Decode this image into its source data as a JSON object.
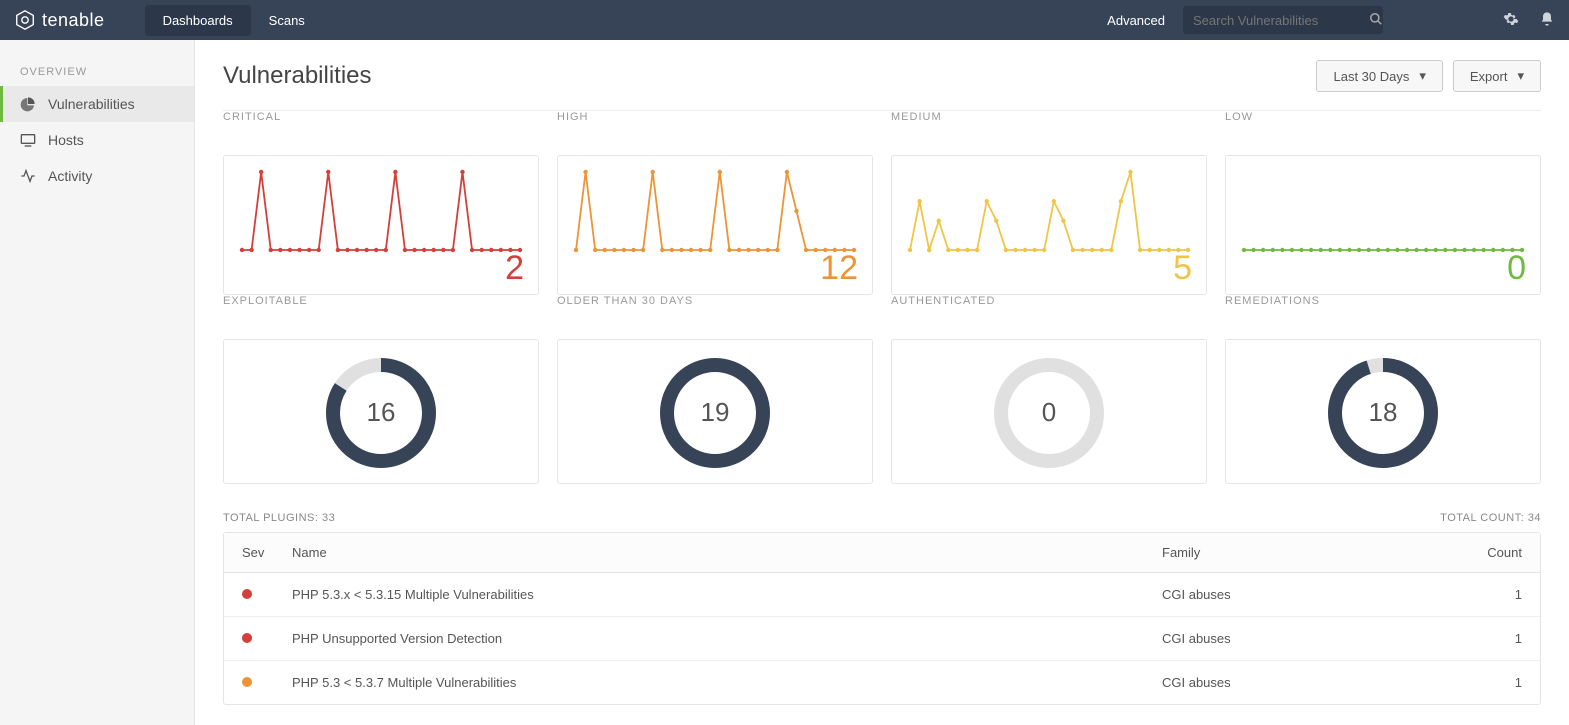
{
  "topbar": {
    "brand": "tenable",
    "nav": {
      "dashboards": "Dashboards",
      "scans": "Scans"
    },
    "advanced": "Advanced",
    "search_placeholder": "Search Vulnerabilities"
  },
  "sidebar": {
    "section": "OVERVIEW",
    "items": {
      "vuln": "Vulnerabilities",
      "hosts": "Hosts",
      "activity": "Activity"
    }
  },
  "page": {
    "title": "Vulnerabilities"
  },
  "buttons": {
    "range": "Last 30 Days",
    "export": "Export"
  },
  "sev_cards": {
    "critical": {
      "label": "CRITICAL",
      "value": "2"
    },
    "high": {
      "label": "HIGH",
      "value": "12"
    },
    "medium": {
      "label": "MEDIUM",
      "value": "5"
    },
    "low": {
      "label": "LOW",
      "value": "0"
    }
  },
  "metric_cards": {
    "exploitable": {
      "label": "EXPLOITABLE",
      "value": "16",
      "pct": 84
    },
    "older": {
      "label": "OLDER THAN 30 DAYS",
      "value": "19",
      "pct": 100
    },
    "auth": {
      "label": "AUTHENTICATED",
      "value": "0",
      "pct": 0
    },
    "remed": {
      "label": "REMEDIATIONS",
      "value": "18",
      "pct": 95
    }
  },
  "table_meta": {
    "plugins": "TOTAL PLUGINS: 33",
    "count": "TOTAL COUNT: 34"
  },
  "columns": {
    "sev": "Sev",
    "name": "Name",
    "family": "Family",
    "count": "Count"
  },
  "rows": [
    {
      "sev": "crit",
      "name": "PHP 5.3.x < 5.3.15 Multiple Vulnerabilities",
      "family": "CGI abuses",
      "count": "1"
    },
    {
      "sev": "crit",
      "name": "PHP Unsupported Version Detection",
      "family": "CGI abuses",
      "count": "1"
    },
    {
      "sev": "high",
      "name": "PHP 5.3 < 5.3.7 Multiple Vulnerabilities",
      "family": "CGI abuses",
      "count": "1"
    }
  ],
  "chart_data": [
    {
      "type": "line",
      "title": "CRITICAL",
      "values": [
        0,
        0,
        2,
        0,
        0,
        0,
        0,
        0,
        0,
        2,
        0,
        0,
        0,
        0,
        0,
        0,
        2,
        0,
        0,
        0,
        0,
        0,
        0,
        2,
        0,
        0,
        0,
        0,
        0,
        0
      ],
      "color": "#d43f3a",
      "ylim": [
        0,
        2
      ]
    },
    {
      "type": "line",
      "title": "HIGH",
      "values": [
        0,
        12,
        0,
        0,
        0,
        0,
        0,
        0,
        12,
        0,
        0,
        0,
        0,
        0,
        0,
        12,
        0,
        0,
        0,
        0,
        0,
        0,
        12,
        6,
        0,
        0,
        0,
        0,
        0,
        0
      ],
      "color": "#ee9336",
      "ylim": [
        0,
        12
      ]
    },
    {
      "type": "line",
      "title": "MEDIUM",
      "values": [
        0,
        5,
        0,
        3,
        0,
        0,
        0,
        0,
        5,
        3,
        0,
        0,
        0,
        0,
        0,
        5,
        3,
        0,
        0,
        0,
        0,
        0,
        5,
        8,
        0,
        0,
        0,
        0,
        0,
        0
      ],
      "color": "#f0c446",
      "ylim": [
        0,
        8
      ]
    },
    {
      "type": "line",
      "title": "LOW",
      "values": [
        0,
        0,
        0,
        0,
        0,
        0,
        0,
        0,
        0,
        0,
        0,
        0,
        0,
        0,
        0,
        0,
        0,
        0,
        0,
        0,
        0,
        0,
        0,
        0,
        0,
        0,
        0,
        0,
        0,
        0
      ],
      "color": "#6fb93f",
      "ylim": [
        0,
        1
      ]
    },
    {
      "type": "donut",
      "title": "EXPLOITABLE",
      "value": 16,
      "pct": 84
    },
    {
      "type": "donut",
      "title": "OLDER THAN 30 DAYS",
      "value": 19,
      "pct": 100
    },
    {
      "type": "donut",
      "title": "AUTHENTICATED",
      "value": 0,
      "pct": 0
    },
    {
      "type": "donut",
      "title": "REMEDIATIONS",
      "value": 18,
      "pct": 95
    }
  ]
}
